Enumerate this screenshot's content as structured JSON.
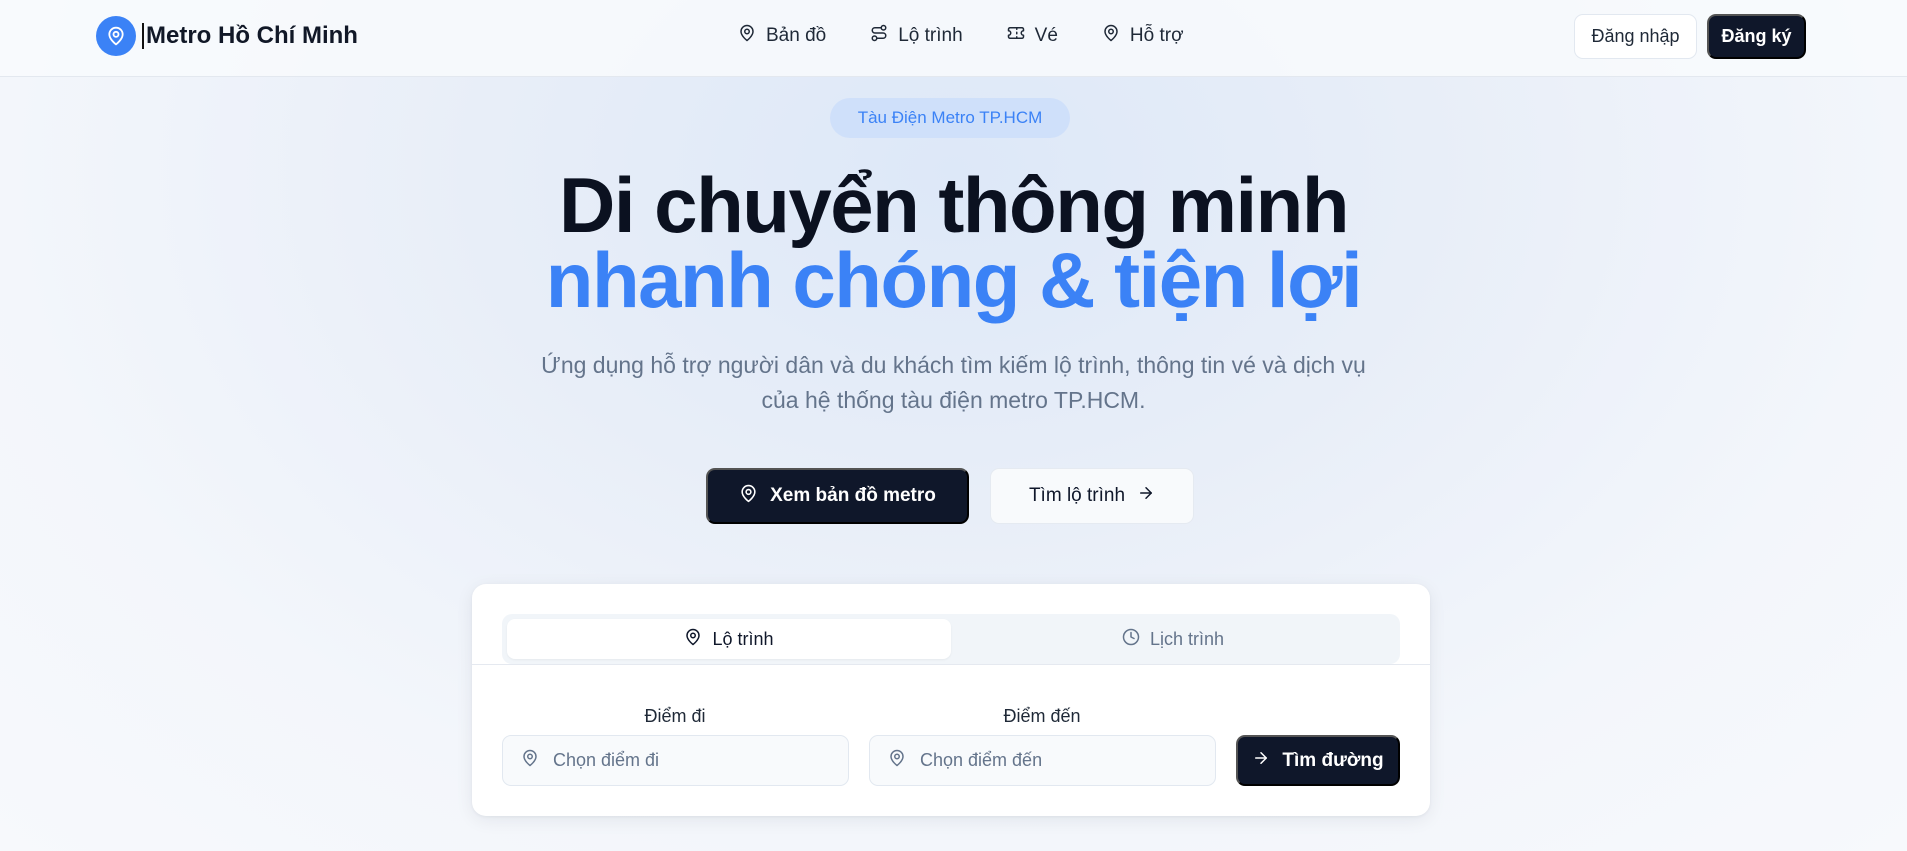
{
  "brand": {
    "name": "Metro Hồ Chí Minh",
    "logo_icon": "map-pin-icon",
    "logo_color": "#3b82f6"
  },
  "nav": {
    "items": [
      {
        "label": "Bản đồ",
        "icon": "map-pin-icon"
      },
      {
        "label": "Lộ trình",
        "icon": "route-icon"
      },
      {
        "label": "Vé",
        "icon": "ticket-icon"
      },
      {
        "label": "Hỗ trợ",
        "icon": "map-pin-icon"
      }
    ],
    "login_label": "Đăng nhập",
    "register_label": "Đăng ký"
  },
  "hero": {
    "badge": "Tàu Điện Metro TP.HCM",
    "title_line1": "Di chuyển thông minh",
    "title_line2": "nhanh chóng & tiện lợi",
    "subtitle": "Ứng dụng hỗ trợ người dân và du khách tìm kiếm lộ trình, thông tin vé và dịch vụ của hệ thống tàu điện metro TP.HCM.",
    "primary_button": "Xem bản đồ metro",
    "secondary_button": "Tìm lộ trình"
  },
  "search_card": {
    "tabs": [
      {
        "label": "Lộ trình",
        "icon": "map-pin-icon",
        "active": true
      },
      {
        "label": "Lịch trình",
        "icon": "clock-icon",
        "active": false
      }
    ],
    "from_label": "Điểm đi",
    "from_placeholder": "Chọn điểm đi",
    "from_value": "",
    "to_label": "Điểm đến",
    "to_placeholder": "Chọn điểm đến",
    "to_value": "",
    "search_button": "Tìm đường"
  },
  "colors": {
    "accent": "#3b82f6",
    "dark": "#0f172a",
    "muted": "#64748b"
  }
}
